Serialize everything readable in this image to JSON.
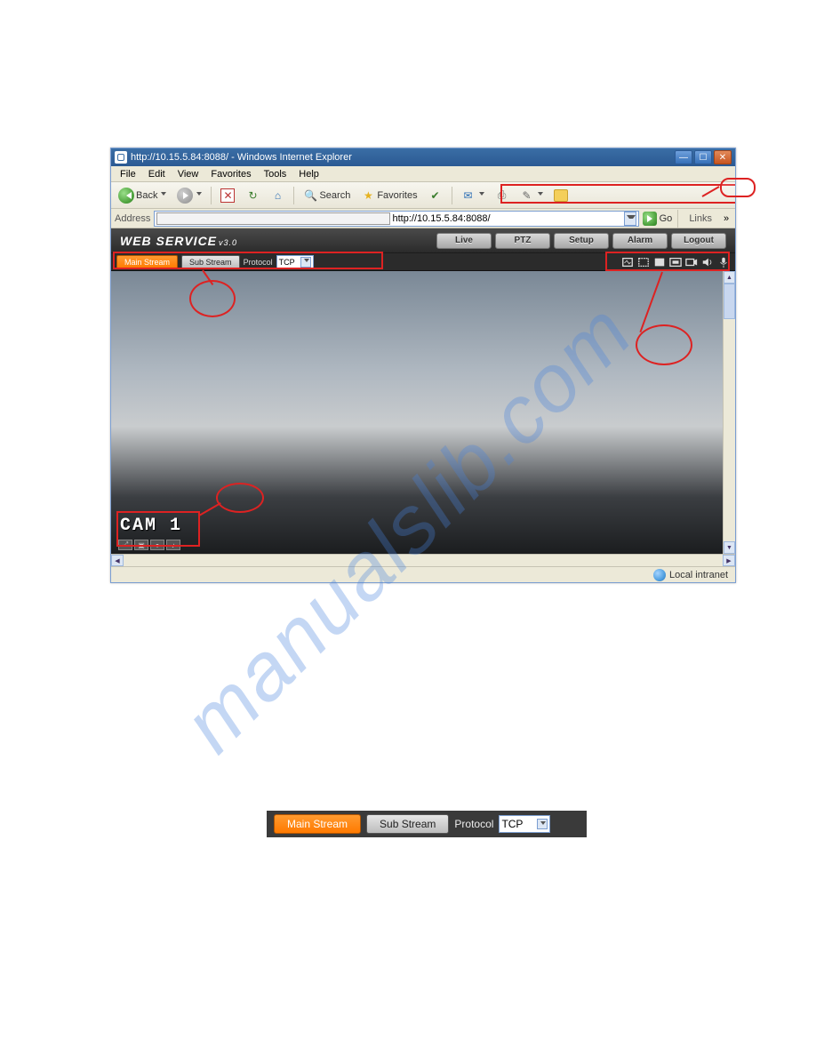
{
  "watermark": "manualslib.com",
  "titlebar": {
    "text": "http://10.15.5.84:8088/ - Windows Internet Explorer"
  },
  "menubar": {
    "file": "File",
    "edit": "Edit",
    "view": "View",
    "favorites": "Favorites",
    "tools": "Tools",
    "help": "Help"
  },
  "toolbar": {
    "back": "Back",
    "search": "Search",
    "favorites": "Favorites"
  },
  "addressbar": {
    "label": "Address",
    "url": "http://10.15.5.84:8088/",
    "go": "Go",
    "links": "Links"
  },
  "webservice": {
    "title_main": "WEB  SERVICE",
    "title_ver": "v3.0",
    "tabs": {
      "live": "Live",
      "ptz": "PTZ",
      "setup": "Setup",
      "alarm": "Alarm",
      "logout": "Logout"
    },
    "stream": {
      "main": "Main Stream",
      "sub": "Sub Stream",
      "protocol_label": "Protocol",
      "protocol_value": "TCP"
    },
    "cam_label": "CAM 1"
  },
  "statusbar": {
    "zone": "Local intranet"
  },
  "encodebar": {
    "main": "Main Stream",
    "sub": "Sub Stream",
    "protocol_label": "Protocol",
    "protocol_value": "TCP"
  }
}
